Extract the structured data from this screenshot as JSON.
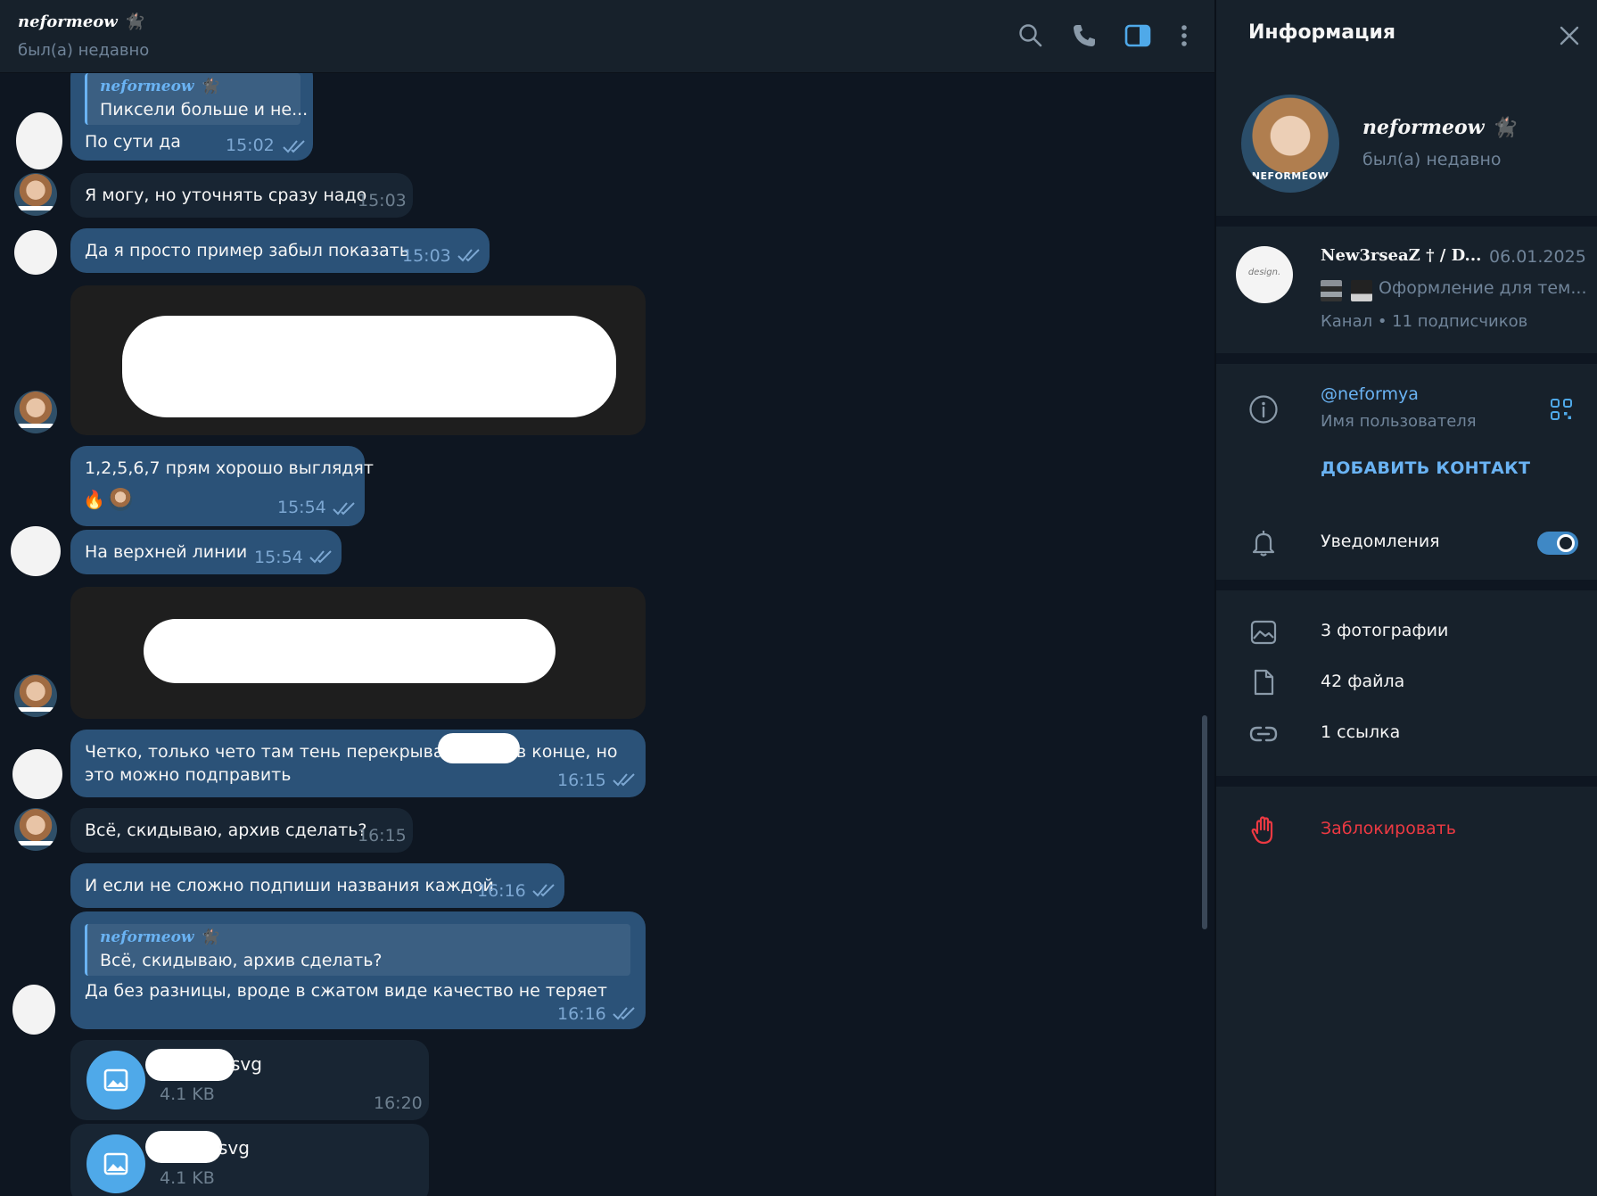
{
  "header": {
    "name": "neformeow 🐈‍⬛",
    "status": "был(а) недавно"
  },
  "messages": {
    "m1": {
      "reply_name": "neformeow 🐈‍⬛",
      "reply_text": "Пиксели больше и не...",
      "text": "По сути да",
      "time": "15:02"
    },
    "m2": {
      "text": "Я могу, но уточнять сразу надо",
      "time": "15:03"
    },
    "m3": {
      "text": "Да я просто пример забыл показать",
      "time": "15:03"
    },
    "m4": {
      "text": "1,2,5,6,7 прям хорошо выглядят",
      "time": "15:54",
      "reaction": "🔥"
    },
    "m5": {
      "text": "На верхней линии",
      "time": "15:54"
    },
    "m6": {
      "text_line1_a": "Четко, только чето там тень перекрывает",
      "text_line1_b": "в конце, но",
      "text_line2": "это можно подправить",
      "time": "16:15"
    },
    "m7": {
      "text": "Всё, скидываю, архив сделать?",
      "time": "16:15"
    },
    "m8": {
      "text": "И если не сложно подпиши названия каждой",
      "time": "16:16"
    },
    "m9": {
      "reply_name": "neformeow 🐈‍⬛",
      "reply_text": "Всё, скидываю, архив сделать?",
      "text": "Да без разницы, вроде в сжатом виде качество не теряет",
      "time": "16:16"
    },
    "f1": {
      "name_suffix": "svg",
      "size": "4.1 KB",
      "time": "16:20"
    },
    "f2": {
      "name_suffix": "svg",
      "size": "4.1 KB"
    }
  },
  "info": {
    "title": "Информация",
    "avatar_caption": "NEFORMEOW",
    "name": "neformeow 🐈‍⬛",
    "status": "был(а) недавно",
    "channel": {
      "avatar_text": "design.",
      "name": "New3rseaZ † / D...",
      "date": "06.01.2025",
      "preview": "Оформление для тем...",
      "meta": "Канал • 11 подписчиков"
    },
    "username": "@neformya",
    "username_label": "Имя пользователя",
    "add_contact": "ДОБАВИТЬ КОНТАКТ",
    "notifications_label": "Уведомления",
    "notifications_on": true,
    "photos": "3 фотографии",
    "files": "42 файла",
    "links": "1 ссылка",
    "block": "Заблокировать"
  },
  "colors": {
    "background": "#0e1621",
    "panel": "#17212b",
    "outgoing_bubble": "#2b5278",
    "incoming_bubble": "#182533",
    "accent": "#6ab3f3",
    "danger": "#ec3942"
  },
  "icons": [
    "search-icon",
    "phone-icon",
    "sidebar-toggle-icon",
    "more-vertical-icon",
    "close-icon",
    "info-icon",
    "qr-code-icon",
    "bell-icon",
    "image-icon",
    "file-icon",
    "link-icon",
    "block-hand-icon"
  ]
}
